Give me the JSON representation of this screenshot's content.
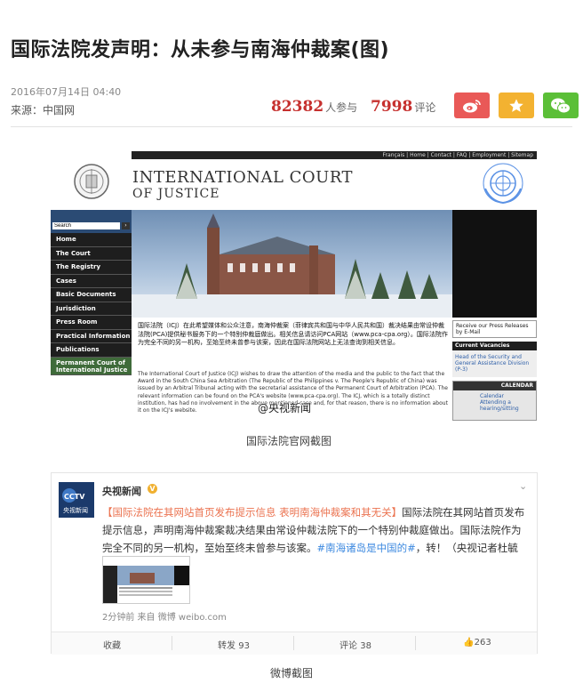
{
  "article": {
    "title": "国际法院发声明：从未参与南海仲裁案(图)",
    "date": "2016年07月14日  04:40",
    "source": "来源：中国网",
    "participants_count": "82382",
    "participants_label": "人参与",
    "comments_count": "7998",
    "comments_label": "评论"
  },
  "share": {
    "weibo_icon": "weibo-icon",
    "favorite_icon": "star-icon",
    "wechat_icon": "wechat-icon",
    "weibo_color": "#e95957",
    "favorite_color": "#f3b231",
    "wechat_color": "#5bbf37"
  },
  "icj": {
    "topbar": "Français | Home | Contact | FAQ | Employment | Sitemap",
    "title_line1": "INTERNATIONAL COURT",
    "title_line2": "OF JUSTICE",
    "search_label": "Search",
    "nav": [
      "Home",
      "The Court",
      "The Registry",
      "Cases",
      "Basic Documents",
      "Jurisdiction",
      "Press Room",
      "Practical Information",
      "Publications",
      "Permanent Court of International Justice"
    ],
    "notice_cn": "国际法院（ICJ）在此希望媒体和公众注意，南海仲裁案（菲律宾共和国与中华人民共和国）裁决结果由常设仲裁法院(PCA)提供秘书服务下的一个特别仲裁庭做出。相关信息请访问PCA网站（www.pca-cpa.org）。国际法院作为完全不同的另一机构，至始至终未曾参与该案，因此在国际法院网站上无法查询到相关信息。",
    "notice_en": "The International Court of Justice (ICJ) wishes to draw the attention of the media and the public to the fact that the Award in the South China Sea Arbitration (The Republic of the Philippines v. The People's Republic of China) was issued by an Arbitral Tribunal acting with the secretarial assistance of the Permanent Court of Arbitration (PCA). The relevant information can be found on the PCA's website (www.pca-cpa.org). The ICJ, which is a totally distinct institution, has had no involvement in the above mentioned case and, for that reason, there is no information about it on the ICJ's website.",
    "receive_press": "Receive our Press Releases by E-Mail",
    "vacancies_head": "Current Vacancies",
    "vacancies_link": "Head of the Security and General Assistance Division (P-3)",
    "calendar_head": "CALENDAR",
    "calendar_links": "Calendar\nAttending a hearing/sitting",
    "watermark": "@央视新闻"
  },
  "caption1": "国际法院官网截图",
  "weibo": {
    "avatar_text": "CCTV 央视新闻",
    "name": "央视新闻",
    "verified_icon": "v-badge-icon",
    "text_link": "【国际法院在其网站首页发布提示信息 表明南海仲裁案和其无关】",
    "text_body": "国际法院在其网站首页发布提示信息，声明南海仲裁案裁决结果由常设仲裁法院下的一个特别仲裁庭做出。国际法院作为完全不同的另一机构，至始至终未曾参与该案。",
    "text_tag": "#南海诸岛是中国的#",
    "text_tail": "，转！（央视记者杜毓斌）",
    "time": "2分钟前 来自 微博 weibo.com",
    "actions": {
      "favorite": "收藏",
      "repost": "转发 93",
      "comment": "评论 38",
      "like": "263"
    }
  },
  "caption2": "微博截图"
}
